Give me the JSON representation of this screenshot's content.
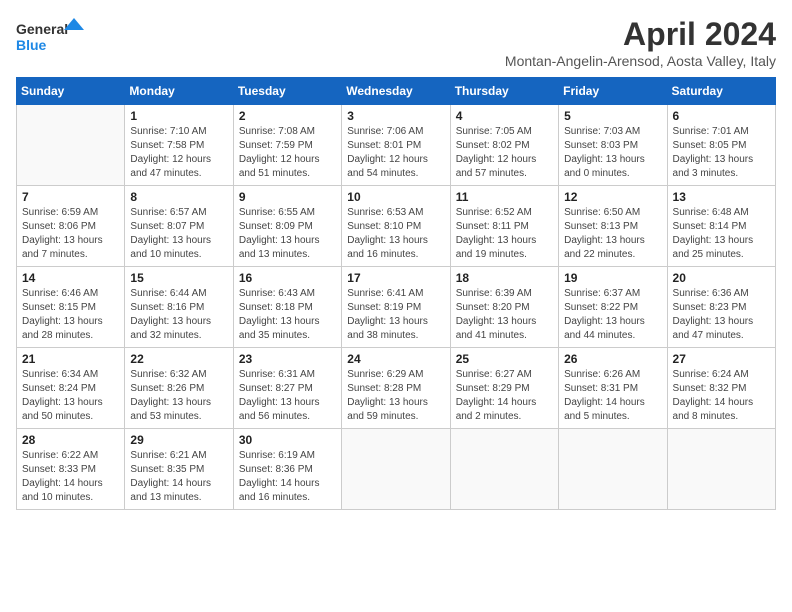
{
  "logo": {
    "line1": "General",
    "line2": "Blue"
  },
  "title": "April 2024",
  "location": "Montan-Angelin-Arensod, Aosta Valley, Italy",
  "weekdays": [
    "Sunday",
    "Monday",
    "Tuesday",
    "Wednesday",
    "Thursday",
    "Friday",
    "Saturday"
  ],
  "weeks": [
    [
      {
        "day": "",
        "sunrise": "",
        "sunset": "",
        "daylight": ""
      },
      {
        "day": "1",
        "sunrise": "Sunrise: 7:10 AM",
        "sunset": "Sunset: 7:58 PM",
        "daylight": "Daylight: 12 hours and 47 minutes."
      },
      {
        "day": "2",
        "sunrise": "Sunrise: 7:08 AM",
        "sunset": "Sunset: 7:59 PM",
        "daylight": "Daylight: 12 hours and 51 minutes."
      },
      {
        "day": "3",
        "sunrise": "Sunrise: 7:06 AM",
        "sunset": "Sunset: 8:01 PM",
        "daylight": "Daylight: 12 hours and 54 minutes."
      },
      {
        "day": "4",
        "sunrise": "Sunrise: 7:05 AM",
        "sunset": "Sunset: 8:02 PM",
        "daylight": "Daylight: 12 hours and 57 minutes."
      },
      {
        "day": "5",
        "sunrise": "Sunrise: 7:03 AM",
        "sunset": "Sunset: 8:03 PM",
        "daylight": "Daylight: 13 hours and 0 minutes."
      },
      {
        "day": "6",
        "sunrise": "Sunrise: 7:01 AM",
        "sunset": "Sunset: 8:05 PM",
        "daylight": "Daylight: 13 hours and 3 minutes."
      }
    ],
    [
      {
        "day": "7",
        "sunrise": "Sunrise: 6:59 AM",
        "sunset": "Sunset: 8:06 PM",
        "daylight": "Daylight: 13 hours and 7 minutes."
      },
      {
        "day": "8",
        "sunrise": "Sunrise: 6:57 AM",
        "sunset": "Sunset: 8:07 PM",
        "daylight": "Daylight: 13 hours and 10 minutes."
      },
      {
        "day": "9",
        "sunrise": "Sunrise: 6:55 AM",
        "sunset": "Sunset: 8:09 PM",
        "daylight": "Daylight: 13 hours and 13 minutes."
      },
      {
        "day": "10",
        "sunrise": "Sunrise: 6:53 AM",
        "sunset": "Sunset: 8:10 PM",
        "daylight": "Daylight: 13 hours and 16 minutes."
      },
      {
        "day": "11",
        "sunrise": "Sunrise: 6:52 AM",
        "sunset": "Sunset: 8:11 PM",
        "daylight": "Daylight: 13 hours and 19 minutes."
      },
      {
        "day": "12",
        "sunrise": "Sunrise: 6:50 AM",
        "sunset": "Sunset: 8:13 PM",
        "daylight": "Daylight: 13 hours and 22 minutes."
      },
      {
        "day": "13",
        "sunrise": "Sunrise: 6:48 AM",
        "sunset": "Sunset: 8:14 PM",
        "daylight": "Daylight: 13 hours and 25 minutes."
      }
    ],
    [
      {
        "day": "14",
        "sunrise": "Sunrise: 6:46 AM",
        "sunset": "Sunset: 8:15 PM",
        "daylight": "Daylight: 13 hours and 28 minutes."
      },
      {
        "day": "15",
        "sunrise": "Sunrise: 6:44 AM",
        "sunset": "Sunset: 8:16 PM",
        "daylight": "Daylight: 13 hours and 32 minutes."
      },
      {
        "day": "16",
        "sunrise": "Sunrise: 6:43 AM",
        "sunset": "Sunset: 8:18 PM",
        "daylight": "Daylight: 13 hours and 35 minutes."
      },
      {
        "day": "17",
        "sunrise": "Sunrise: 6:41 AM",
        "sunset": "Sunset: 8:19 PM",
        "daylight": "Daylight: 13 hours and 38 minutes."
      },
      {
        "day": "18",
        "sunrise": "Sunrise: 6:39 AM",
        "sunset": "Sunset: 8:20 PM",
        "daylight": "Daylight: 13 hours and 41 minutes."
      },
      {
        "day": "19",
        "sunrise": "Sunrise: 6:37 AM",
        "sunset": "Sunset: 8:22 PM",
        "daylight": "Daylight: 13 hours and 44 minutes."
      },
      {
        "day": "20",
        "sunrise": "Sunrise: 6:36 AM",
        "sunset": "Sunset: 8:23 PM",
        "daylight": "Daylight: 13 hours and 47 minutes."
      }
    ],
    [
      {
        "day": "21",
        "sunrise": "Sunrise: 6:34 AM",
        "sunset": "Sunset: 8:24 PM",
        "daylight": "Daylight: 13 hours and 50 minutes."
      },
      {
        "day": "22",
        "sunrise": "Sunrise: 6:32 AM",
        "sunset": "Sunset: 8:26 PM",
        "daylight": "Daylight: 13 hours and 53 minutes."
      },
      {
        "day": "23",
        "sunrise": "Sunrise: 6:31 AM",
        "sunset": "Sunset: 8:27 PM",
        "daylight": "Daylight: 13 hours and 56 minutes."
      },
      {
        "day": "24",
        "sunrise": "Sunrise: 6:29 AM",
        "sunset": "Sunset: 8:28 PM",
        "daylight": "Daylight: 13 hours and 59 minutes."
      },
      {
        "day": "25",
        "sunrise": "Sunrise: 6:27 AM",
        "sunset": "Sunset: 8:29 PM",
        "daylight": "Daylight: 14 hours and 2 minutes."
      },
      {
        "day": "26",
        "sunrise": "Sunrise: 6:26 AM",
        "sunset": "Sunset: 8:31 PM",
        "daylight": "Daylight: 14 hours and 5 minutes."
      },
      {
        "day": "27",
        "sunrise": "Sunrise: 6:24 AM",
        "sunset": "Sunset: 8:32 PM",
        "daylight": "Daylight: 14 hours and 8 minutes."
      }
    ],
    [
      {
        "day": "28",
        "sunrise": "Sunrise: 6:22 AM",
        "sunset": "Sunset: 8:33 PM",
        "daylight": "Daylight: 14 hours and 10 minutes."
      },
      {
        "day": "29",
        "sunrise": "Sunrise: 6:21 AM",
        "sunset": "Sunset: 8:35 PM",
        "daylight": "Daylight: 14 hours and 13 minutes."
      },
      {
        "day": "30",
        "sunrise": "Sunrise: 6:19 AM",
        "sunset": "Sunset: 8:36 PM",
        "daylight": "Daylight: 14 hours and 16 minutes."
      },
      {
        "day": "",
        "sunrise": "",
        "sunset": "",
        "daylight": ""
      },
      {
        "day": "",
        "sunrise": "",
        "sunset": "",
        "daylight": ""
      },
      {
        "day": "",
        "sunrise": "",
        "sunset": "",
        "daylight": ""
      },
      {
        "day": "",
        "sunrise": "",
        "sunset": "",
        "daylight": ""
      }
    ]
  ]
}
